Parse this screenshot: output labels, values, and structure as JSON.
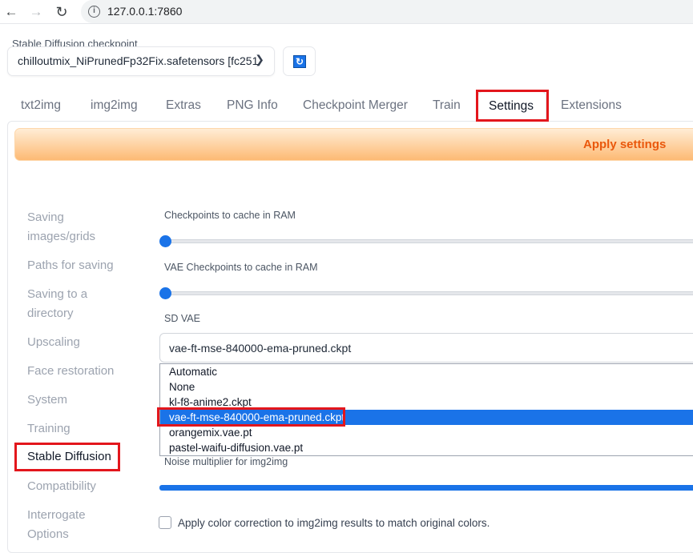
{
  "browser": {
    "url": "127.0.0.1:7860",
    "icons": [
      "back-arrow-icon",
      "forward-arrow-icon",
      "reload-icon",
      "info-icon"
    ]
  },
  "checkpoint": {
    "label": "Stable Diffusion checkpoint",
    "value": "chilloutmix_NiPrunedFp32Fix.safetensors [fc251",
    "refresh_icon": "refresh-icon"
  },
  "tabs": [
    "txt2img",
    "img2img",
    "Extras",
    "PNG Info",
    "Checkpoint Merger",
    "Train",
    "Settings",
    "Extensions"
  ],
  "active_tab": "Settings",
  "apply_label": "Apply settings",
  "sidebar": {
    "items": [
      {
        "line1": "Saving",
        "line2": "images/grids"
      },
      {
        "line1": "Paths for saving"
      },
      {
        "line1": "Saving to a",
        "line2": "directory"
      },
      {
        "line1": "Upscaling"
      },
      {
        "line1": "Face restoration"
      },
      {
        "line1": "System"
      },
      {
        "line1": "Training"
      },
      {
        "line1": "Stable Diffusion"
      },
      {
        "line1": "Compatibility"
      },
      {
        "line1": "Interrogate",
        "line2": "Options"
      }
    ],
    "active": "Stable Diffusion"
  },
  "settings": {
    "ckpt_cache_label": "Checkpoints to cache in RAM",
    "ckpt_cache_value": 0,
    "vae_cache_label": "VAE Checkpoints to cache in RAM",
    "vae_cache_value": 0,
    "sd_vae_label": "SD VAE",
    "sd_vae_value": "vae-ft-mse-840000-ema-pruned.ckpt",
    "sd_vae_options": [
      "Automatic",
      "None",
      "kl-f8-anime2.ckpt",
      "vae-ft-mse-840000-ema-pruned.ckpt",
      "orangemix.vae.pt",
      "pastel-waifu-diffusion.vae.pt"
    ],
    "sd_vae_selected": "vae-ft-mse-840000-ema-pruned.ckpt",
    "noise_label": "Noise multiplier for img2img",
    "noise_value": 1.0,
    "color_correction_label": "Apply color correction to img2img results to match original colors.",
    "color_correction_checked": false
  },
  "colors": {
    "accent": "#1a73e8",
    "highlight_box": "#e3161c",
    "apply_text": "#ea580c"
  }
}
